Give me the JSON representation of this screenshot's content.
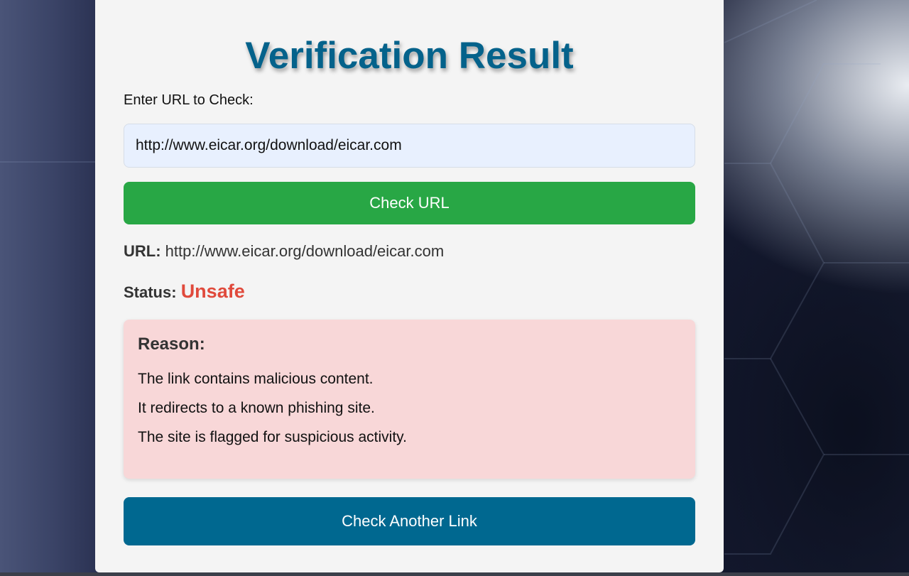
{
  "page": {
    "title": "Verification Result"
  },
  "form": {
    "url_label": "Enter URL to Check:",
    "url_value": "http://www.eicar.org/download/eicar.com",
    "check_button_label": "Check URL"
  },
  "result": {
    "url_label": "URL:",
    "url_value": "http://www.eicar.org/download/eicar.com",
    "status_label": "Status:",
    "status_value": "Unsafe"
  },
  "reason": {
    "heading": "Reason:",
    "items": [
      "The link contains malicious content.",
      "It redirects to a known phishing site.",
      "The site is flagged for suspicious activity."
    ]
  },
  "actions": {
    "check_another_label": "Check Another Link"
  },
  "colors": {
    "title": "#04628b",
    "check_button": "#28a745",
    "check_another_button": "#006890",
    "status_unsafe": "#e04a3c",
    "reason_background": "#f8d7d8",
    "input_background": "#e8f0fe"
  }
}
